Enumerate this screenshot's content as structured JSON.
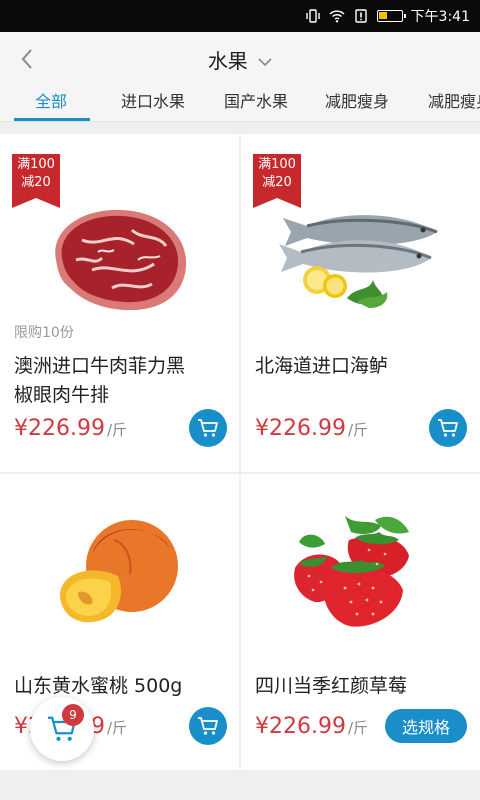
{
  "status_bar": {
    "time": "下午3:41"
  },
  "header": {
    "title": "水果"
  },
  "tabs": [
    {
      "label": "全部",
      "active": true
    },
    {
      "label": "进口水果"
    },
    {
      "label": "国产水果"
    },
    {
      "label": "减肥瘦身"
    },
    {
      "label": "减肥瘦身"
    }
  ],
  "products": [
    {
      "name_line1": "澳洲进口牛肉菲力黑",
      "name_line2": "椒眼肉牛排",
      "price": "¥226.99",
      "unit": "/斤",
      "badge_line1": "满100",
      "badge_line2": "减20",
      "limit": "限购10份",
      "image": "steak"
    },
    {
      "name_line1": "北海道进口海鲈",
      "price": "¥226.99",
      "unit": "/斤",
      "badge_line1": "满100",
      "badge_line2": "减20",
      "image": "fish"
    },
    {
      "name_line1": "山东黄水蜜桃 500g",
      "price": "¥226.99",
      "unit": "/斤",
      "image": "peach"
    },
    {
      "name_line1": "四川当季红颜草莓",
      "price": "¥226.99",
      "unit": "/斤",
      "action_label": "选规格",
      "image": "strawberry"
    }
  ],
  "cart": {
    "count": "9"
  },
  "colors": {
    "accent": "#1a8ec9",
    "price": "#d0393e",
    "badge": "#c7282d"
  }
}
